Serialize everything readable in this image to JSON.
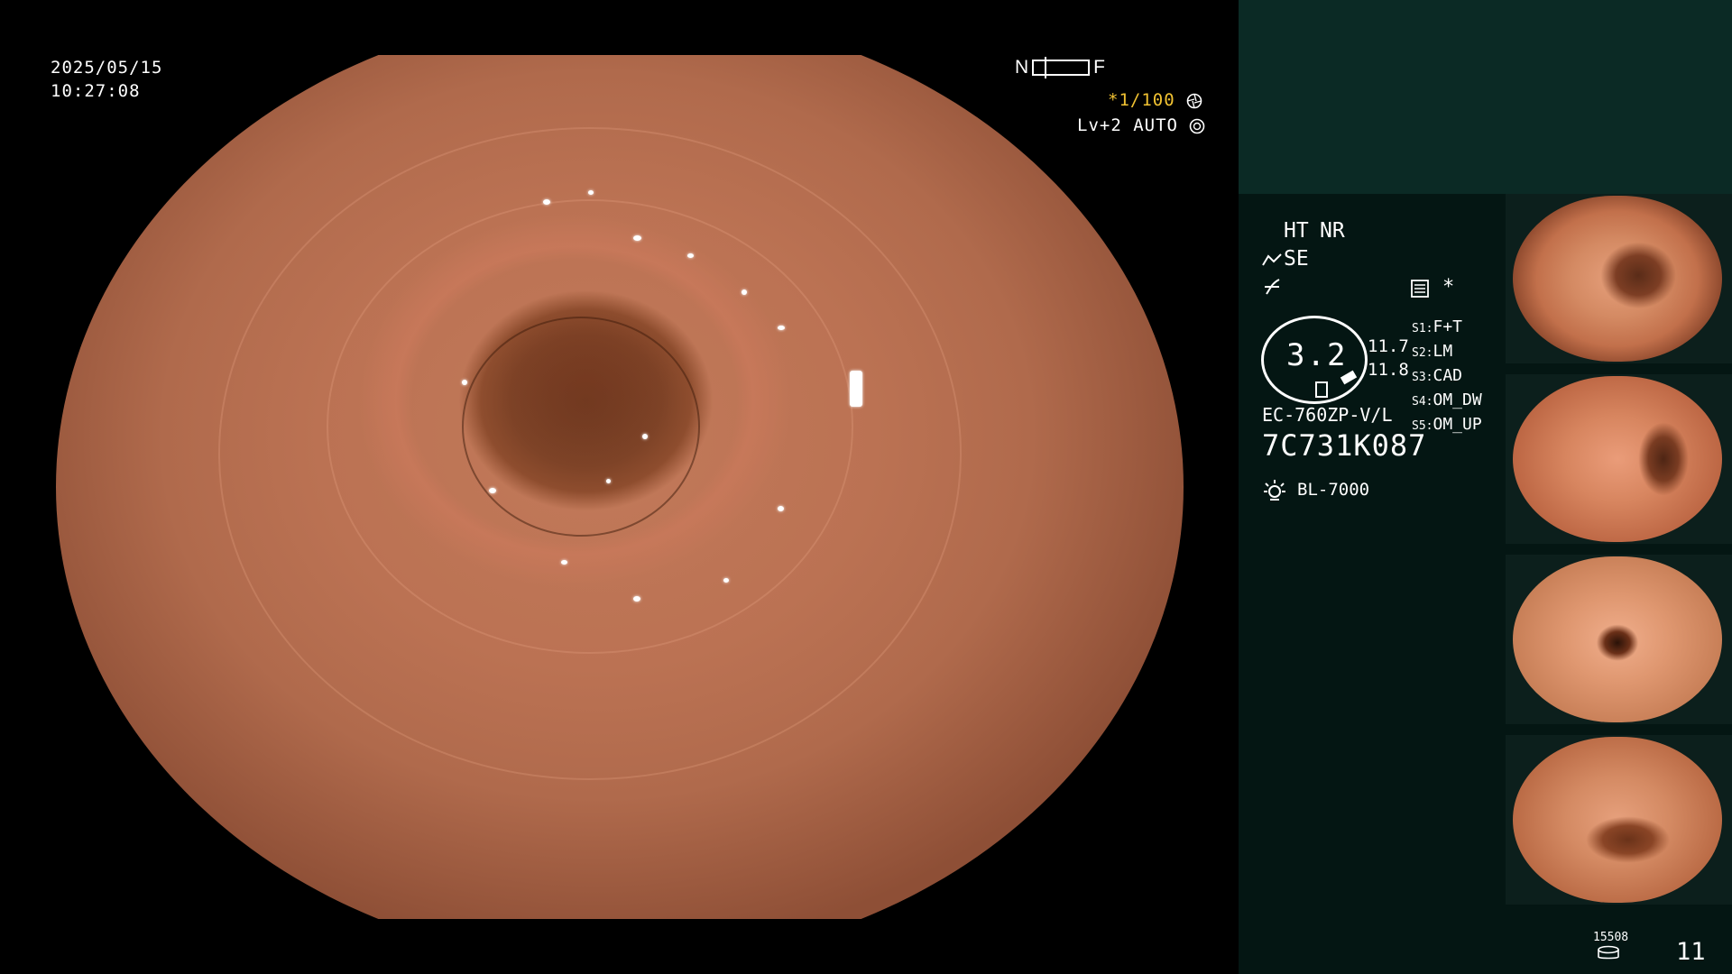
{
  "overlay": {
    "date": "2025/05/15",
    "time": "10:27:08",
    "nf_left": "N",
    "nf_right": "F",
    "shutter": "*1/100",
    "level": "Lv+2 AUTO"
  },
  "panel": {
    "ht": "HT",
    "nr": "NR",
    "se": "SE",
    "star": "*",
    "zoom_value": "3.2",
    "zoom_side_1": "11.7",
    "zoom_side_2": "11.8",
    "modes": [
      {
        "key": "S1:",
        "value": "F+T"
      },
      {
        "key": "S2:",
        "value": "LM"
      },
      {
        "key": "S3:",
        "value": "CAD"
      },
      {
        "key": "S4:",
        "value": "OM_DW"
      },
      {
        "key": "S5:",
        "value": "OM_UP"
      }
    ],
    "scope_model": "EC-760ZP-V/L",
    "serial": "7C731K087",
    "light_source": "BL-7000",
    "storage_count": "15508",
    "image_count": "11"
  },
  "colors": {
    "panel_bg": "#041613",
    "panel_top_bg": "#0b2a25",
    "accent_yellow": "#f1c232"
  },
  "icons": {
    "shutter": "aperture-icon",
    "auto": "iris-icon",
    "enhance": "enhance-mode-icon",
    "color": "color-mode-icon",
    "capture": "capture-icon",
    "light": "light-source-icon",
    "storage": "storage-icon"
  }
}
